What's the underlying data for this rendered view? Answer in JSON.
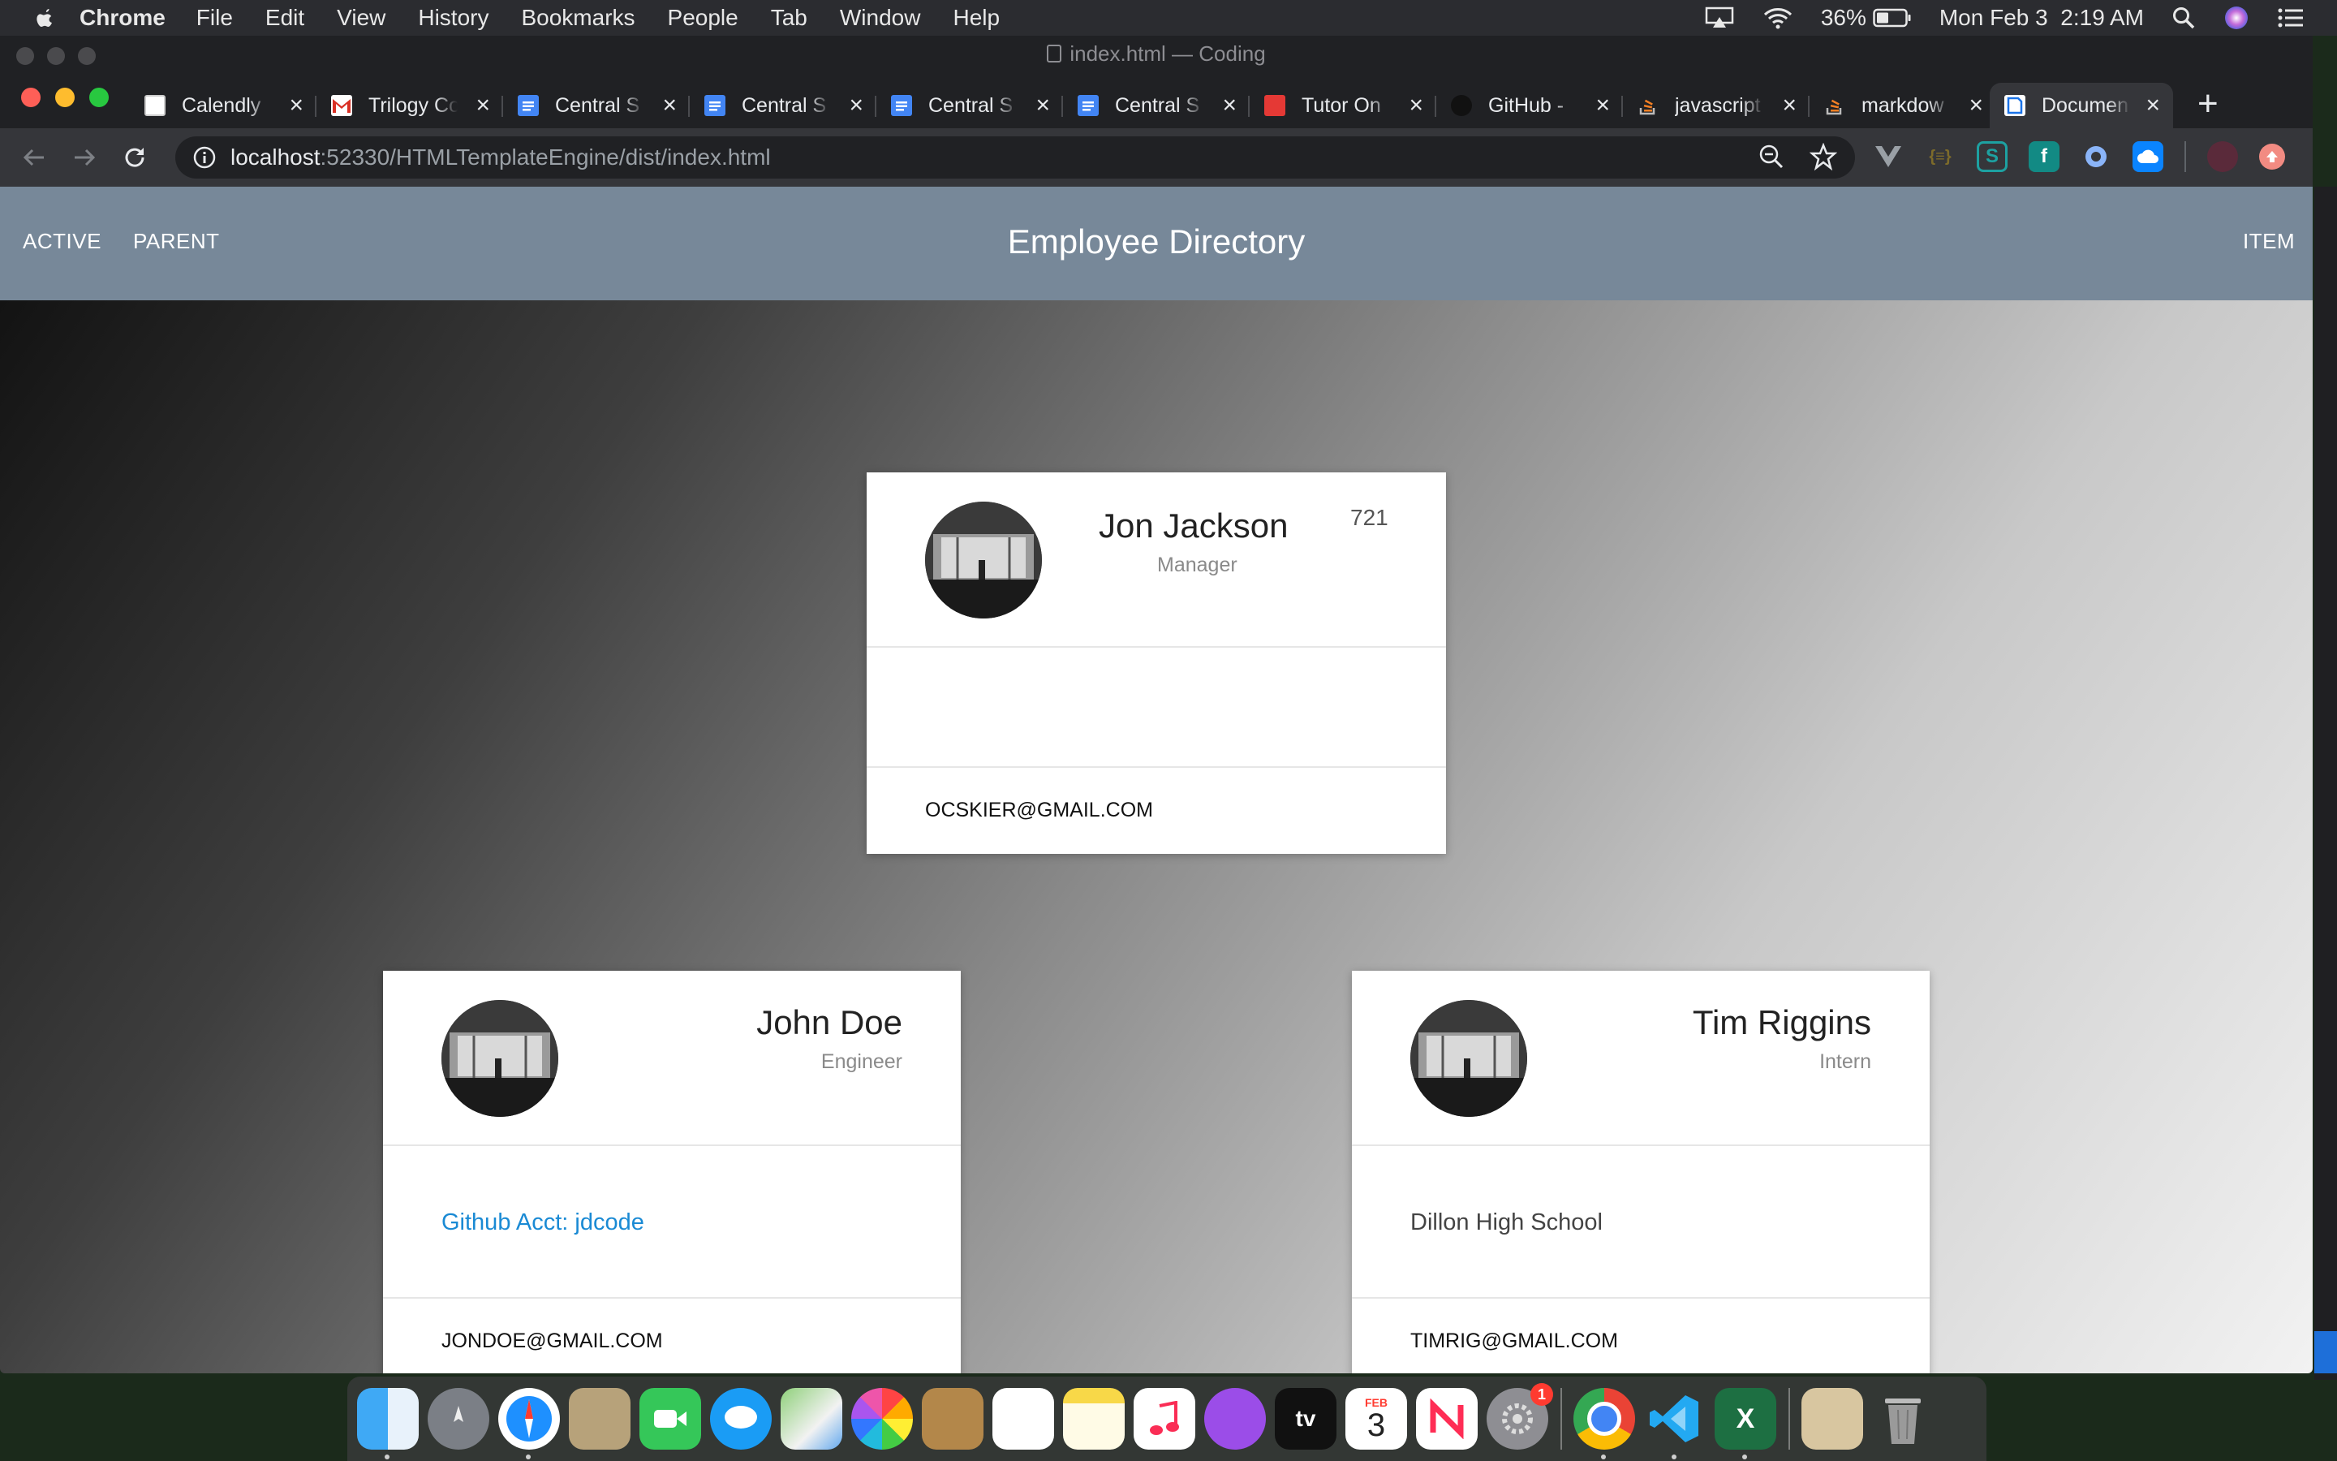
{
  "menubar": {
    "app": "Chrome",
    "items": [
      "File",
      "Edit",
      "View",
      "History",
      "Bookmarks",
      "People",
      "Tab",
      "Window",
      "Help"
    ],
    "battery": "36%",
    "clock": "Mon Feb 3  2:19 AM"
  },
  "window": {
    "title": "index.html — Coding"
  },
  "tabs": [
    {
      "label": "Calendly",
      "icon": "calendly-icon",
      "color": "#ffffff"
    },
    {
      "label": "Trilogy Co",
      "icon": "gmail-icon",
      "color": "#d93025"
    },
    {
      "label": "Central S",
      "icon": "google-docs-icon",
      "color": "#4285f4"
    },
    {
      "label": "Central S",
      "icon": "google-docs-icon",
      "color": "#4285f4"
    },
    {
      "label": "Central S",
      "icon": "google-docs-icon",
      "color": "#4285f4"
    },
    {
      "label": "Central S",
      "icon": "google-docs-icon",
      "color": "#4285f4"
    },
    {
      "label": "Tutor On",
      "icon": "video-icon",
      "color": "#e53935"
    },
    {
      "label": "GitHub -",
      "icon": "github-icon",
      "color": "#111111"
    },
    {
      "label": "javascript",
      "icon": "stackoverflow-icon",
      "color": "#f48024"
    },
    {
      "label": "markdow",
      "icon": "stackoverflow-icon",
      "color": "#f48024"
    },
    {
      "label": "Documen",
      "icon": "document-icon",
      "color": "#1a73e8",
      "active": true
    }
  ],
  "address": {
    "host": "localhost",
    "path": ":52330/HTMLTemplateEngine/dist/index.html"
  },
  "navbar": {
    "left_links": [
      "ACTIVE",
      "PARENT"
    ],
    "title": "Employee Directory",
    "right_link": "ITEM"
  },
  "employees": [
    {
      "name": "Jon Jackson",
      "role": "Manager",
      "count": "721",
      "detail": "",
      "email": "OCSKIER@GMAIL.COM"
    },
    {
      "name": "John Doe",
      "role": "Engineer",
      "count": "",
      "detail": "Github Acct: jdcode",
      "detail_color": "#1a8ad4",
      "email": "JONDOE@GMAIL.COM"
    },
    {
      "name": "Tim Riggins",
      "role": "Intern",
      "count": "",
      "detail": "Dillon High School",
      "detail_color": "#444444",
      "email": "TIMRIG@GMAIL.COM"
    }
  ],
  "dock": {
    "calendar_month": "FEB",
    "calendar_day": "3",
    "settings_badge": "1",
    "tv_label": "tv"
  },
  "colors": {
    "navbar": "#778899",
    "tab_active": "#35363a",
    "chrome_dark": "#202124"
  }
}
